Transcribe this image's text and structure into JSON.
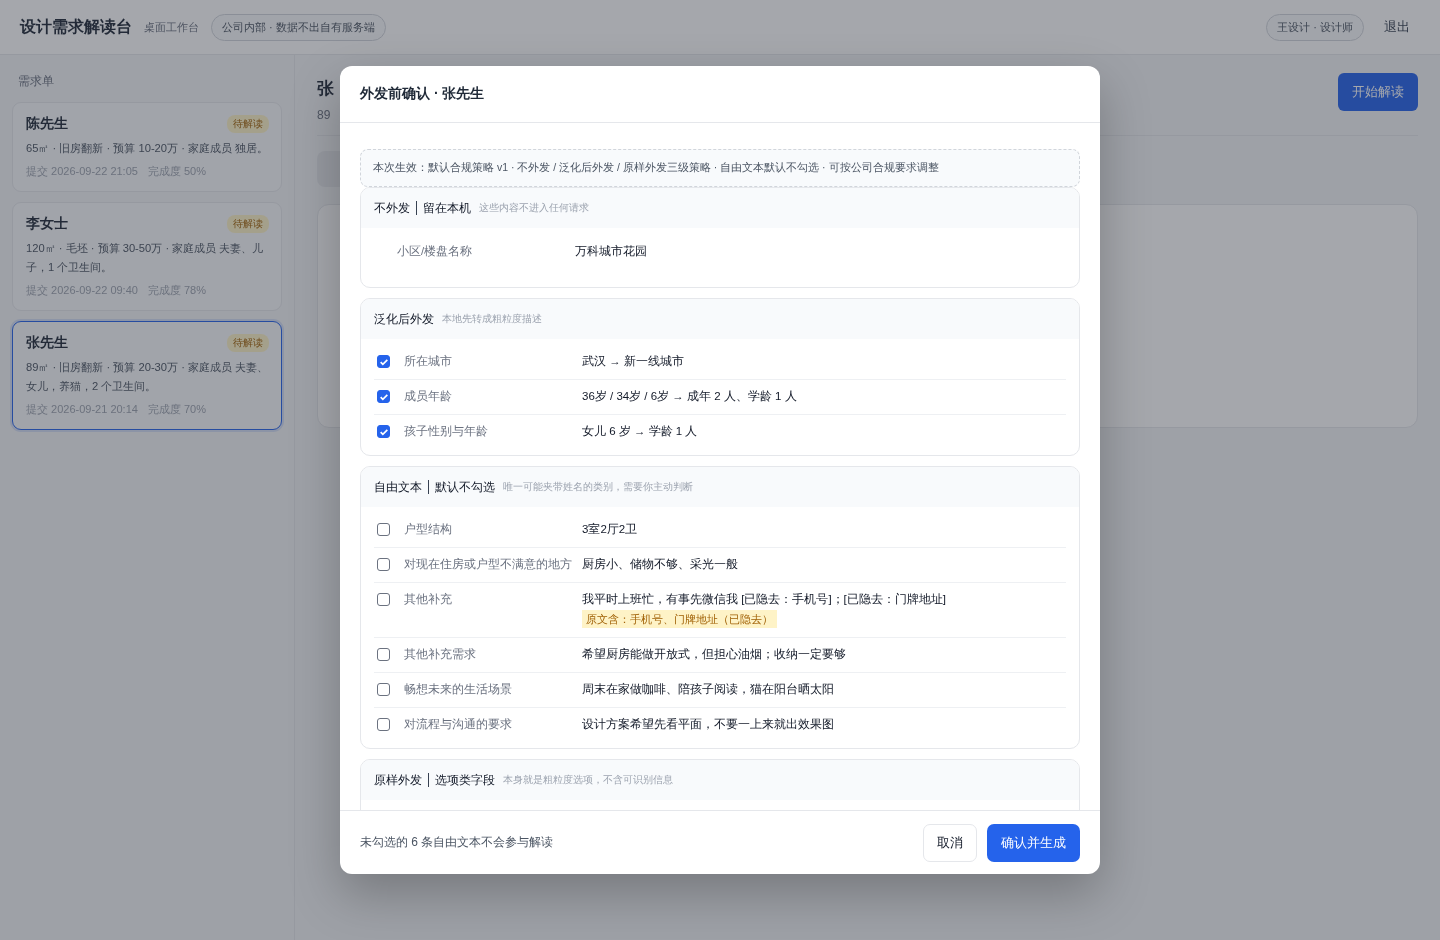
{
  "header": {
    "title": "设计需求解读台",
    "subtitle": "桌面工作台",
    "badge": "公司内部 · 数据不出自有服务端",
    "user": "王设计 · 设计师",
    "logout": "退出"
  },
  "sidebar": {
    "heading": "需求单",
    "items": [
      {
        "name": "陈先生",
        "status": "待解读",
        "desc": "65㎡ · 旧房翻新 · 预算 10-20万 · 家庭成员 独居。",
        "submitted": "提交 2026-09-22 21:05",
        "progress": "完成度 50%",
        "selected": false
      },
      {
        "name": "李女士",
        "status": "待解读",
        "desc": "120㎡ · 毛坯 · 预算 30-50万 · 家庭成员 夫妻、儿子，1 个卫生间。",
        "submitted": "提交 2026-09-22 09:40",
        "progress": "完成度 78%",
        "selected": false
      },
      {
        "name": "张先生",
        "status": "待解读",
        "desc": "89㎡ · 旧房翻新 · 预算 20-30万 · 家庭成员 夫妻、女儿，养猫，2 个卫生间。",
        "submitted": "提交 2026-09-21 20:14",
        "progress": "完成度 70%",
        "selected": true
      }
    ]
  },
  "main": {
    "title": "张",
    "meta": "89",
    "action": "开始解读"
  },
  "modal": {
    "title": "外发前确认 · 张先生",
    "notice": "本次生效：默认合规策略 v1 · 不外发 / 泛化后外发 / 原样外发三级策略 · 自由文本默认不勾选 · 可按公司合规要求调整",
    "sections": [
      {
        "title": "不外发",
        "title_suffix": "留在本机",
        "note": "这些内容不进入任何请求",
        "rows": [
          {
            "kind": "plain",
            "label": "小区/楼盘名称",
            "value": "万科城市花园"
          }
        ]
      },
      {
        "title": "泛化后外发",
        "note": "本地先转成粗粒度描述",
        "rows": [
          {
            "kind": "check",
            "checked": true,
            "label": "所在城市",
            "value": "武汉 → 新一线城市"
          },
          {
            "kind": "check",
            "checked": true,
            "label": "成员年龄",
            "value": "36岁 / 34岁 / 6岁 → 成年 2 人、学龄 1 人"
          },
          {
            "kind": "check",
            "checked": true,
            "label": "孩子性别与年龄",
            "value": "女儿 6 岁 → 学龄 1 人"
          }
        ]
      },
      {
        "title": "自由文本",
        "title_suffix": "默认不勾选",
        "note": "唯一可能夹带姓名的类别，需要你主动判断",
        "rows": [
          {
            "kind": "check",
            "checked": false,
            "label": "户型结构",
            "value": "3室2厅2卫"
          },
          {
            "kind": "check",
            "checked": false,
            "label": "对现在住房或户型不满意的地方",
            "value": "厨房小、储物不够、采光一般"
          },
          {
            "kind": "check",
            "checked": false,
            "label": "其他补充",
            "value": "我平时上班忙，有事先微信我 [已隐去：手机号]；[已隐去：门牌地址]",
            "tag": "原文含：手机号、门牌地址（已隐去）"
          },
          {
            "kind": "check",
            "checked": false,
            "label": "其他补充需求",
            "value": "希望厨房能做开放式，但担心油烟；收纳一定要够"
          },
          {
            "kind": "check",
            "checked": false,
            "label": "畅想未来的生活场景",
            "value": "周末在家做咖啡、陪孩子阅读，猫在阳台晒太阳"
          },
          {
            "kind": "check",
            "checked": false,
            "label": "对流程与沟通的要求",
            "value": "设计方案希望先看平面，不要一上来就出效果图"
          }
        ]
      },
      {
        "title": "原样外发",
        "title_suffix": "选项类字段",
        "note": "本身就是粗粒度选项，不含可识别信息"
      }
    ],
    "footer_note": "未勾选的 6 条自由文本不会参与解读",
    "cancel": "取消",
    "confirm": "确认并生成"
  }
}
